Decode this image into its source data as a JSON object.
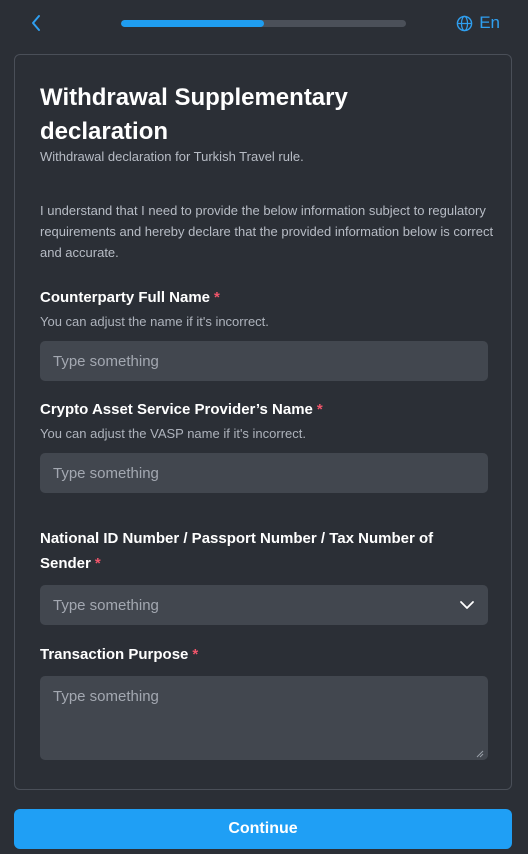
{
  "header": {
    "language": "En",
    "progress": 0.5
  },
  "form": {
    "title": "Withdrawal Supplementary declaration",
    "subtitle": "Withdrawal declaration for Turkish Travel rule.",
    "declaration": "I understand that I need to provide the below information subject to regulatory requirements and hereby declare that the provided information below is correct and accurate.",
    "required_marker": "*",
    "fields": [
      {
        "label": "Counterparty Full Name",
        "hint": "You can adjust the name if it's incorrect.",
        "placeholder": "Type something",
        "value": ""
      },
      {
        "label": "Crypto Asset Service Provider’s Name",
        "hint": "You can adjust the VASP name if it's incorrect.",
        "placeholder": "Type something",
        "value": ""
      },
      {
        "label": "National ID Number / Passport Number / Tax Number of Sender",
        "placeholder": "Type something",
        "value": ""
      },
      {
        "label": "Transaction Purpose",
        "placeholder": "Type something",
        "value": ""
      }
    ]
  },
  "footer": {
    "continue_label": "Continue"
  },
  "colors": {
    "accent": "#1f9ff5",
    "background": "#2b2f36",
    "input_bg": "#42474f",
    "required": "#f0556a"
  }
}
